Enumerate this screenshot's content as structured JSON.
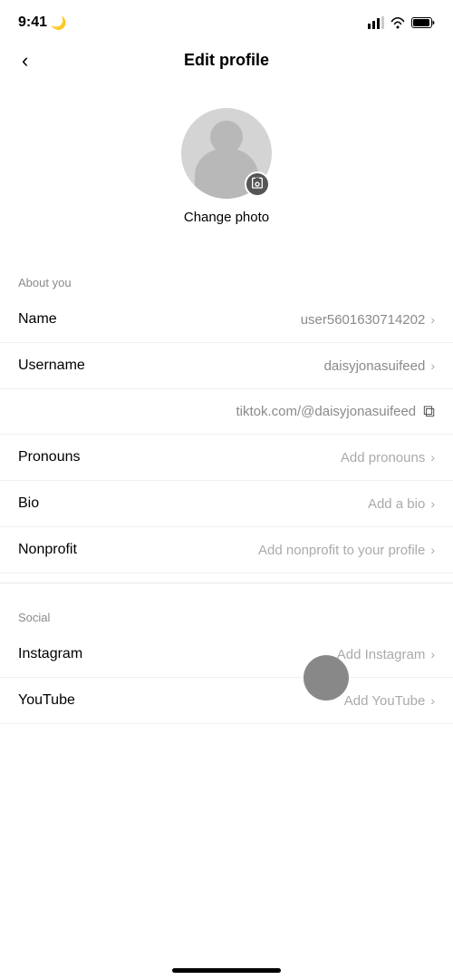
{
  "statusBar": {
    "time": "9:41",
    "moonIcon": "🌙"
  },
  "navBar": {
    "title": "Edit profile",
    "backLabel": "‹"
  },
  "profileSection": {
    "changePhotoLabel": "Change photo"
  },
  "aboutSection": {
    "sectionLabel": "About you",
    "rows": [
      {
        "id": "name",
        "label": "Name",
        "value": "user5601630714202",
        "placeholder": false,
        "showChevron": true
      },
      {
        "id": "username",
        "label": "Username",
        "value": "daisyjonasuifeed",
        "placeholder": false,
        "showChevron": true
      },
      {
        "id": "pronouns",
        "label": "Pronouns",
        "value": "Add pronouns",
        "placeholder": true,
        "showChevron": true
      },
      {
        "id": "bio",
        "label": "Bio",
        "value": "Add a bio",
        "placeholder": true,
        "showChevron": true
      },
      {
        "id": "nonprofit",
        "label": "Nonprofit",
        "value": "Add nonprofit to your profile",
        "placeholder": true,
        "showChevron": true
      }
    ],
    "tiktokUrl": "tiktok.com/@daisyjonasuifeed"
  },
  "socialSection": {
    "sectionLabel": "Social",
    "rows": [
      {
        "id": "instagram",
        "label": "Instagram",
        "value": "Add Instagram",
        "placeholder": true,
        "showChevron": true
      },
      {
        "id": "youtube",
        "label": "YouTube",
        "value": "Add YouTube",
        "placeholder": true,
        "showChevron": true
      }
    ]
  }
}
